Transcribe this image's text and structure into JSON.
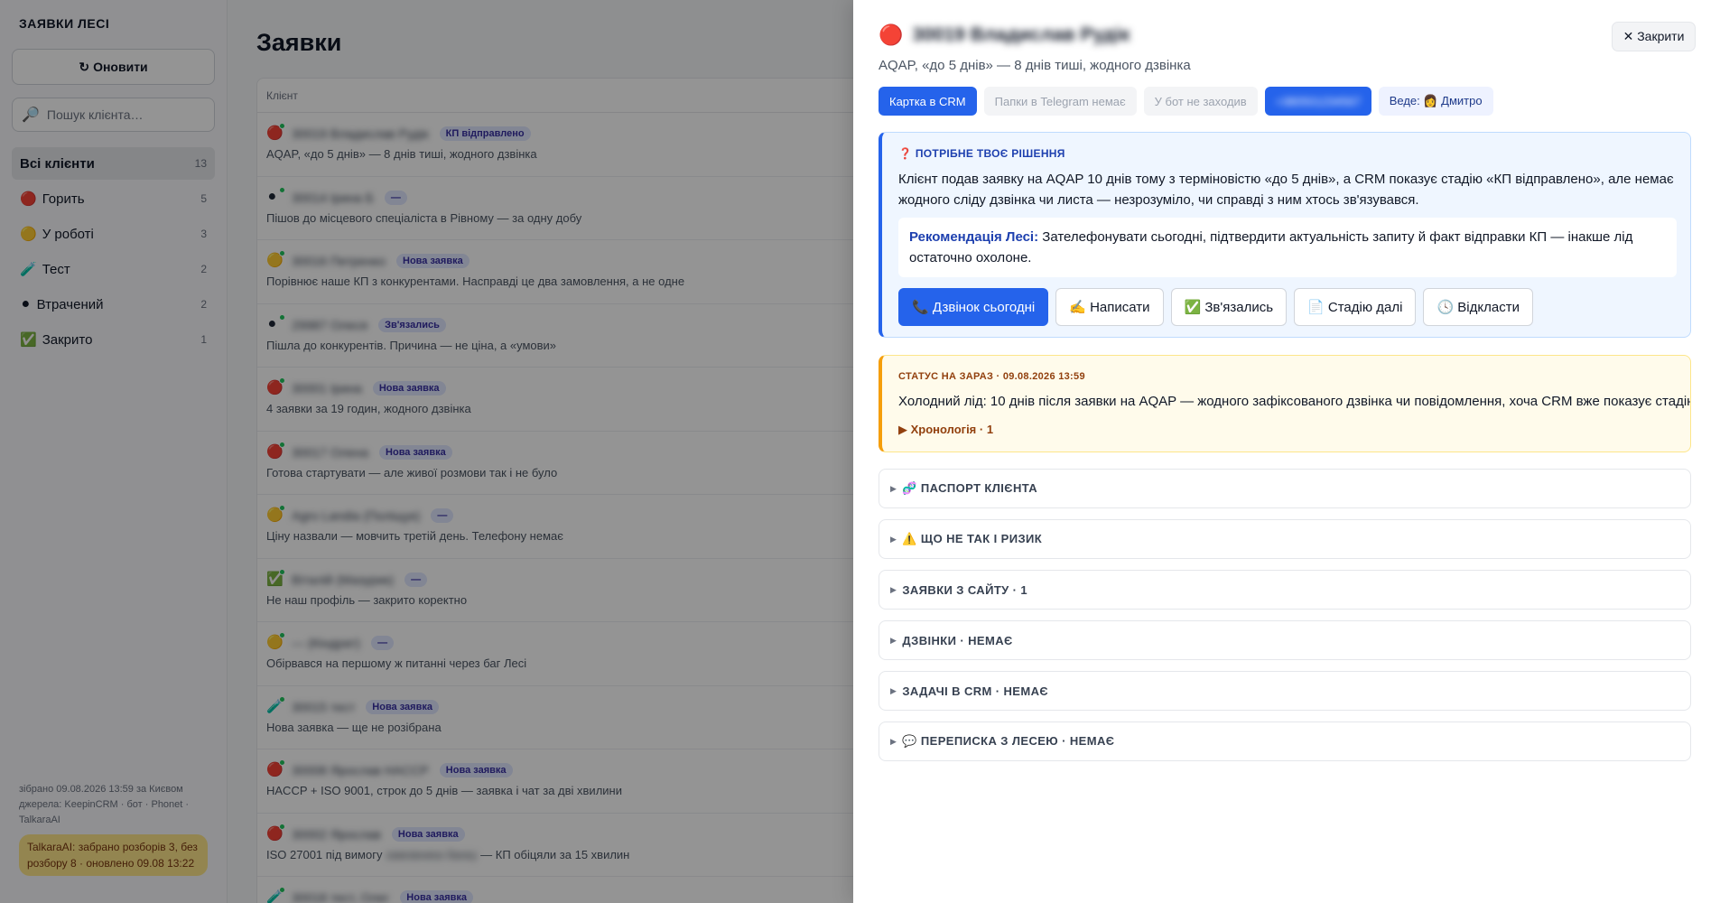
{
  "sidebar": {
    "title": "ЗАЯВКИ ЛЕСІ",
    "refresh_icon": "↻",
    "refresh_label": "Оновити",
    "search_icon": "🔎",
    "search_placeholder": "Пошук клієнта…",
    "categories": [
      {
        "icon": "",
        "label": "Всі клієнти",
        "count": "13"
      },
      {
        "icon": "🔴",
        "label": "Горить",
        "count": "5"
      },
      {
        "icon": "🟡",
        "label": "У роботі",
        "count": "3"
      },
      {
        "icon": "🧪",
        "label": "Тест",
        "count": "2"
      },
      {
        "icon": "⚫",
        "label": "Втрачений",
        "count": "2"
      },
      {
        "icon": "✅",
        "label": "Закрито",
        "count": "1"
      }
    ],
    "footer": "зібрано 09.08.2026 13:59 за Києвом джерела: KeepinCRM · бот · Phonet · TalkaraAI",
    "badge": "TalkaraAI: забрано розборів 3, без розбору 8 · оновлено 09.08 13:22"
  },
  "main": {
    "title": "Заявки",
    "column_client": "Клієнт",
    "rows": [
      {
        "icon": "🔴",
        "name": "30019 Владислав Рудік",
        "tag": "КП відправлено",
        "sub": "AQAP, «до 5 днів» — 8 днів тиші, жодного дзвінка"
      },
      {
        "icon": "⚫",
        "name": "30014 Ірина Б",
        "tag": "—",
        "sub": "Пішов до місцевого спеціаліста в Рівному — за одну добу"
      },
      {
        "icon": "🟡",
        "name": "30016 Петренко",
        "tag": "Нова заявка",
        "sub": "Порівнює наше КП з конкурентами. Насправді це два замовлення, а не одне"
      },
      {
        "icon": "⚫",
        "name": "29987 Олеся",
        "tag": "Зв'язались",
        "sub": "Пішла до конкурентів. Причина — не ціна, а «умови»"
      },
      {
        "icon": "🔴",
        "name": "30001 Ірина",
        "tag": "Нова заявка",
        "sub": "4 заявки за 19 годин, жодного дзвінка"
      },
      {
        "icon": "🔴",
        "name": "30017 Олена",
        "tag": "Нова заявка",
        "sub": "Готова стартувати — але живої розмови так і не було"
      },
      {
        "icon": "🟡",
        "name": "Agro Landia (Поліщук)",
        "tag": "—",
        "sub": "Ціну назвали — мовчить третій день. Телефону немає"
      },
      {
        "icon": "✅",
        "name": "Віталій (Мазурик)",
        "tag": "—",
        "sub": "Не наш профіль — закрито коректно"
      },
      {
        "icon": "🟡",
        "name": "— (Кіндрат)",
        "tag": "—",
        "sub": "Обірвався на першому ж питанні через баг Лесі"
      },
      {
        "icon": "🧪",
        "name": "30015 тест",
        "tag": "Нова заявка",
        "sub": "Нова заявка — ще не розібрана"
      },
      {
        "icon": "🔴",
        "name": "30008 Ярослав HACCP",
        "tag": "Нова заявка",
        "sub": "HACCP + ISO 9001, строк до 5 днів — заявка і чат за дві хвилини"
      },
      {
        "icon": "🔴",
        "name": "30002 Ярослав",
        "tag": "Нова заявка",
        "sub_pre": "ISO 27001 під вимогу",
        "sub_blur": "замовника банку",
        "sub_post": " — КП обіцяли за 15 хвилин"
      },
      {
        "icon": "🧪",
        "name": "30018 тест, Олег",
        "tag": "Нова заявка",
        "sub": ""
      }
    ]
  },
  "panel": {
    "icon": "🔴",
    "name": "30019 Владислав Рудік",
    "close_label": "✕ Закрити",
    "subtitle": "AQAP, «до 5 днів» — 8 днів тиші, жодного дзвінка",
    "chips": {
      "crm": "Картка в CRM",
      "telegram": "Папки в Telegram немає",
      "bot": "У бот не заходив",
      "phone": "+380501234567",
      "lead": "Веде: 👩 Дмитро"
    },
    "decision": {
      "title": "❓ ПОТРІБНЕ ТВОЄ РІШЕННЯ",
      "text": "Клієнт подав заявку на AQAP 10 днів тому з терміновістю «до 5 днів», а CRM показує стадію «КП відправлено», але немає жодного сліду дзвінка чи листа — незрозуміло, чи справді з ним хтось зв'язувався.",
      "rec_label": "Рекомендація Лесі:",
      "rec_text": " Зателефонувати сьогодні, підтвердити актуальність запиту й факт відправки КП — інакше лід остаточно охолоне.",
      "actions": [
        "📞 Дзвінок сьогодні",
        "✍️ Написати",
        "✅ Зв'язались",
        "📄 Стадію далі",
        "🕓 Відкласти"
      ]
    },
    "status": {
      "title": "СТАТУС НА ЗАРАЗ · 09.08.2026 13:59",
      "text": "Холодний лід: 10 днів після заявки на AQAP — жодного зафіксованого дзвінка чи повідомлення, хоча CRM вже показує стадію «КП",
      "timeline": "▶ Хронологія · 1"
    },
    "accordions": [
      "🧬 ПАСПОРТ КЛІЄНТА",
      "⚠️ ЩО НЕ ТАК І РИЗИК",
      "ЗАЯВКИ З САЙТУ · 1",
      "ДЗВІНКИ · НЕМАЄ",
      "ЗАДАЧІ В CRM · НЕМАЄ",
      "💬 ПЕРЕПИСКА З ЛЕСЕЮ · НЕМАЄ"
    ]
  }
}
